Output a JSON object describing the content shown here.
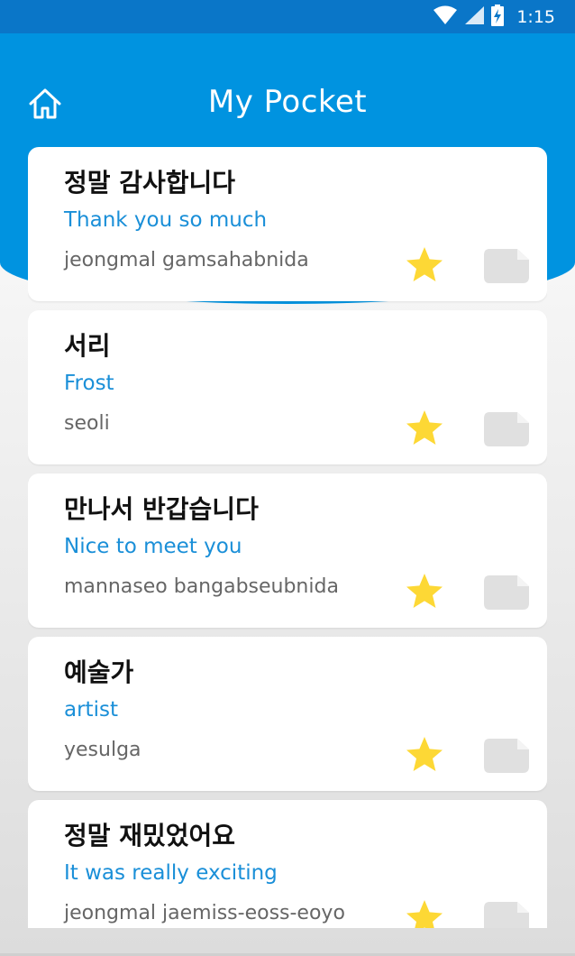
{
  "status_bar": {
    "time": "1:15"
  },
  "header": {
    "title": "My Pocket",
    "home_icon": "home-icon"
  },
  "cards": [
    {
      "korean": "정말 감사합니다",
      "english": "Thank you so much",
      "romanization": "jeongmal gamsahabnida"
    },
    {
      "korean": "서리",
      "english": "Frost",
      "romanization": "seoli"
    },
    {
      "korean": "만나서 반갑습니다",
      "english": "Nice to meet you",
      "romanization": "mannaseo bangabseubnida"
    },
    {
      "korean": "예술가",
      "english": "artist",
      "romanization": "yesulga"
    },
    {
      "korean": "정말 재밌었어요",
      "english": "It was really exciting",
      "romanization": "jeongmal jaemiss-eoss-eoyo"
    }
  ],
  "colors": {
    "header": "#0093e0",
    "status": "#0a76c8",
    "accent_text": "#1a8fd8",
    "star": "#fdd835",
    "note": "#e0e0e0"
  },
  "icons": {
    "favorite": "star-icon",
    "note": "note-icon",
    "wifi": "wifi-icon",
    "signal": "signal-icon",
    "battery": "battery-icon"
  }
}
